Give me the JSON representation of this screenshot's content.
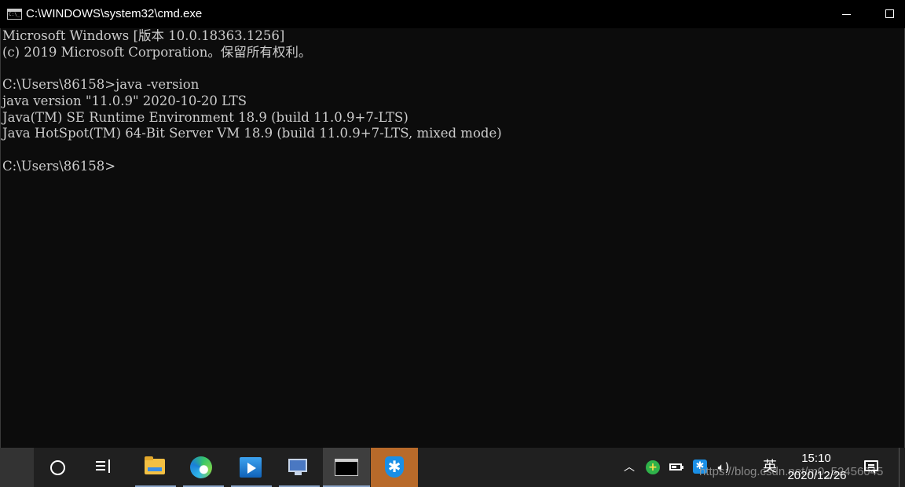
{
  "window": {
    "title": "C:\\WINDOWS\\system32\\cmd.exe",
    "app_icon_text": "C:\\_"
  },
  "console": {
    "lines": [
      "Microsoft Windows [版本 10.0.18363.1256]",
      "(c) 2019 Microsoft Corporation。保留所有权利。",
      "",
      "C:\\Users\\86158>java -version",
      "java version \"11.0.9\" 2020-10-20 LTS",
      "Java(TM) SE Runtime Environment 18.9 (build 11.0.9+7-LTS)",
      "Java HotSpot(TM) 64-Bit Server VM 18.9 (build 11.0.9+7-LTS, mixed mode)",
      "",
      "C:\\Users\\86158>"
    ]
  },
  "taskbar": {
    "pinned": [
      {
        "name": "file-explorer",
        "icon": "folder-icon"
      },
      {
        "name": "edge",
        "icon": "edge-icon"
      },
      {
        "name": "media-player",
        "icon": "media-player-icon"
      },
      {
        "name": "remote-desktop",
        "icon": "remote-desktop-icon"
      },
      {
        "name": "command-prompt",
        "icon": "terminal-icon",
        "active": true
      },
      {
        "name": "starred-app",
        "icon": "star-shield-icon"
      }
    ],
    "tray": {
      "chevron": "^",
      "ime": "英",
      "time": "15:10",
      "date": "2020/12/26"
    }
  },
  "watermark": {
    "text": "https://blog.csdn.net/m0_52456045"
  },
  "colors": {
    "console_bg": "#0c0c0c",
    "console_fg": "#cccccc",
    "titlebar_bg": "#000000",
    "taskbar_bg": "#202020",
    "active_highlight": "#b86a2a"
  }
}
